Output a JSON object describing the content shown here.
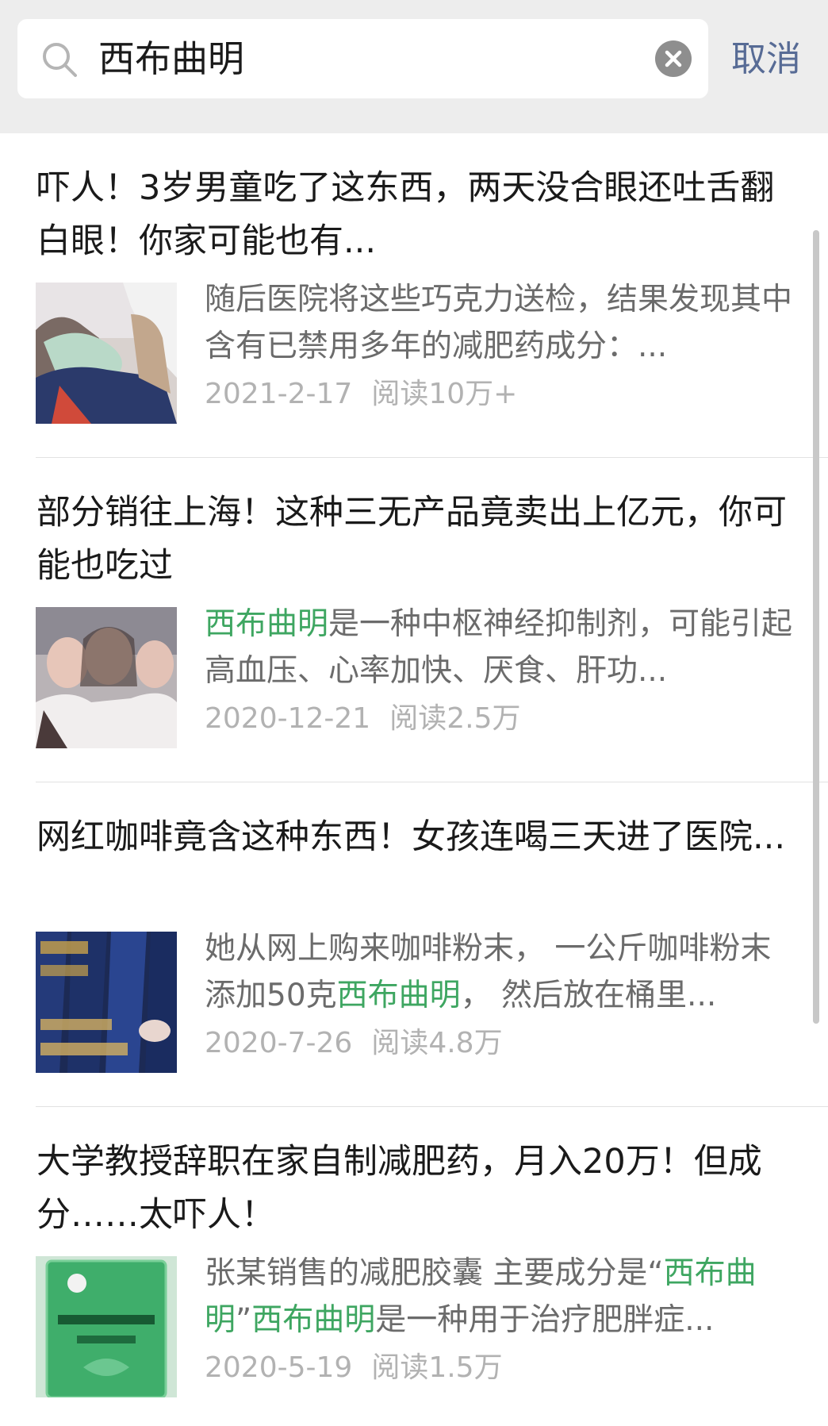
{
  "search": {
    "query": "西布曲明",
    "cancel_label": "取消"
  },
  "colors": {
    "header_bg": "#ededed",
    "highlight": "#3ea661",
    "link_blue": "#576b95",
    "snippet_gray": "#6b6b6b",
    "meta_gray": "#b2b2b2"
  },
  "icons": [
    "search-icon",
    "clear-icon"
  ],
  "articles": [
    {
      "title": "吓人！3岁男童吃了这东西，两天没合眼还吐舌翻白眼！你家可能也有...",
      "snippet": [
        {
          "text": "随后医院将这些巧克力送检，结果发现其中含有已禁用多年的减肥药成分：...",
          "hl": false
        }
      ],
      "date": "2021-2-17",
      "reads": "阅读10万+",
      "thumb": "child-photo"
    },
    {
      "title": "部分销往上海！这种三无产品竟卖出上亿元，你可能也吃过",
      "snippet": [
        {
          "text": "西布曲明",
          "hl": true
        },
        {
          "text": "是一种中枢神经抑制剂，可能引起高血压、心率加快、厌食、肝功...",
          "hl": false
        }
      ],
      "date": "2020-12-21",
      "reads": "阅读2.5万",
      "thumb": "women-photo"
    },
    {
      "title": "网红咖啡竟含这种东西！女孩连喝三天进了医院...",
      "snippet": [
        {
          "text": "她从网上购来咖啡粉末， 一公斤咖啡粉末添加50克",
          "hl": false
        },
        {
          "text": "西布曲明",
          "hl": true
        },
        {
          "text": "， 然后放在桶里...",
          "hl": false
        }
      ],
      "date": "2020-7-26",
      "reads": "阅读4.8万",
      "thumb": "coffee-sachets-photo"
    },
    {
      "title": "大学教授辞职在家自制减肥药，月入20万！但成分……太吓人！",
      "snippet": [
        {
          "text": "张某销售的减肥胶囊 主要成分是“",
          "hl": false
        },
        {
          "text": "西布曲明",
          "hl": true
        },
        {
          "text": "”",
          "hl": false
        },
        {
          "text": "西布曲明",
          "hl": true
        },
        {
          "text": "是一种用于治疗肥胖症...",
          "hl": false
        }
      ],
      "date": "2020-5-19",
      "reads": "阅读1.5万",
      "thumb": "pill-box-photo"
    }
  ]
}
